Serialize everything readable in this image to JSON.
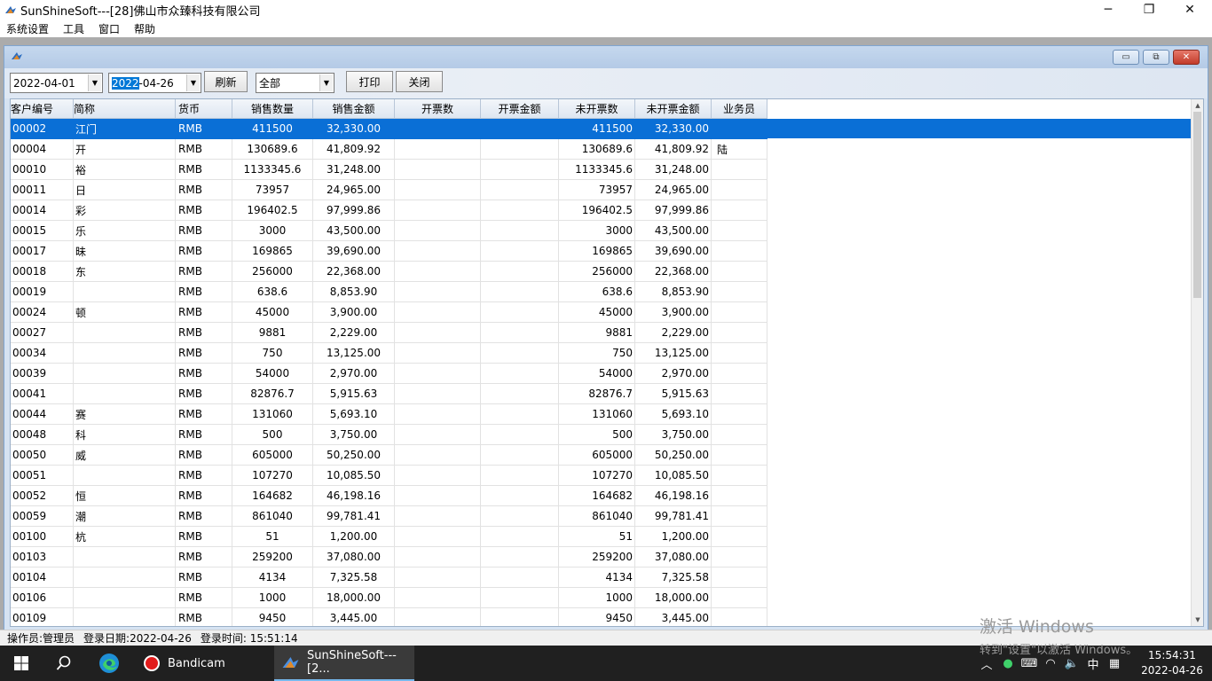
{
  "window": {
    "title": "SunShineSoft---[28]佛山市众臻科技有限公司",
    "minimize": "─",
    "maximize": "❐",
    "close": "✕"
  },
  "menu": [
    "系统设置",
    "工具",
    "窗口",
    "帮助"
  ],
  "child_window": {
    "minimize": "▭",
    "restore": "⧉",
    "close": "✕"
  },
  "toolbar": {
    "date_from": "2022-04-01",
    "date_to_selected": "2022",
    "date_to_rest": "-04-26",
    "refresh": "刷新",
    "filter": "全部",
    "print": "打印",
    "close": "关闭"
  },
  "columns": [
    "客户编号",
    "简称",
    "货币",
    "销售数量",
    "销售金额",
    "开票数",
    "开票金额",
    "未开票数",
    "未开票金额",
    "业务员"
  ],
  "rows": [
    {
      "code": "00002",
      "name": "江门",
      "cur": "RMB",
      "qty": "411500",
      "amt": "32,330.00",
      "inv": "",
      "invamt": "",
      "unq": "411500",
      "unamt": "32,330.00",
      "rep": ""
    },
    {
      "code": "00004",
      "name": "开",
      "cur": "RMB",
      "qty": "130689.6",
      "amt": "41,809.92",
      "inv": "",
      "invamt": "",
      "unq": "130689.6",
      "unamt": "41,809.92",
      "rep": "陆"
    },
    {
      "code": "00010",
      "name": "裕",
      "cur": "RMB",
      "qty": "1133345.6",
      "amt": "31,248.00",
      "inv": "",
      "invamt": "",
      "unq": "1133345.6",
      "unamt": "31,248.00",
      "rep": ""
    },
    {
      "code": "00011",
      "name": "日",
      "cur": "RMB",
      "qty": "73957",
      "amt": "24,965.00",
      "inv": "",
      "invamt": "",
      "unq": "73957",
      "unamt": "24,965.00",
      "rep": ""
    },
    {
      "code": "00014",
      "name": "彩",
      "cur": "RMB",
      "qty": "196402.5",
      "amt": "97,999.86",
      "inv": "",
      "invamt": "",
      "unq": "196402.5",
      "unamt": "97,999.86",
      "rep": ""
    },
    {
      "code": "00015",
      "name": "乐",
      "cur": "RMB",
      "qty": "3000",
      "amt": "43,500.00",
      "inv": "",
      "invamt": "",
      "unq": "3000",
      "unamt": "43,500.00",
      "rep": ""
    },
    {
      "code": "00017",
      "name": "昧",
      "cur": "RMB",
      "qty": "169865",
      "amt": "39,690.00",
      "inv": "",
      "invamt": "",
      "unq": "169865",
      "unamt": "39,690.00",
      "rep": ""
    },
    {
      "code": "00018",
      "name": "东",
      "cur": "RMB",
      "qty": "256000",
      "amt": "22,368.00",
      "inv": "",
      "invamt": "",
      "unq": "256000",
      "unamt": "22,368.00",
      "rep": ""
    },
    {
      "code": "00019",
      "name": "",
      "cur": "RMB",
      "qty": "638.6",
      "amt": "8,853.90",
      "inv": "",
      "invamt": "",
      "unq": "638.6",
      "unamt": "8,853.90",
      "rep": ""
    },
    {
      "code": "00024",
      "name": "顿",
      "cur": "RMB",
      "qty": "45000",
      "amt": "3,900.00",
      "inv": "",
      "invamt": "",
      "unq": "45000",
      "unamt": "3,900.00",
      "rep": ""
    },
    {
      "code": "00027",
      "name": "",
      "cur": "RMB",
      "qty": "9881",
      "amt": "2,229.00",
      "inv": "",
      "invamt": "",
      "unq": "9881",
      "unamt": "2,229.00",
      "rep": ""
    },
    {
      "code": "00034",
      "name": "",
      "cur": "RMB",
      "qty": "750",
      "amt": "13,125.00",
      "inv": "",
      "invamt": "",
      "unq": "750",
      "unamt": "13,125.00",
      "rep": ""
    },
    {
      "code": "00039",
      "name": "",
      "cur": "RMB",
      "qty": "54000",
      "amt": "2,970.00",
      "inv": "",
      "invamt": "",
      "unq": "54000",
      "unamt": "2,970.00",
      "rep": ""
    },
    {
      "code": "00041",
      "name": "",
      "cur": "RMB",
      "qty": "82876.7",
      "amt": "5,915.63",
      "inv": "",
      "invamt": "",
      "unq": "82876.7",
      "unamt": "5,915.63",
      "rep": ""
    },
    {
      "code": "00044",
      "name": "赛",
      "cur": "RMB",
      "qty": "131060",
      "amt": "5,693.10",
      "inv": "",
      "invamt": "",
      "unq": "131060",
      "unamt": "5,693.10",
      "rep": ""
    },
    {
      "code": "00048",
      "name": "科",
      "cur": "RMB",
      "qty": "500",
      "amt": "3,750.00",
      "inv": "",
      "invamt": "",
      "unq": "500",
      "unamt": "3,750.00",
      "rep": ""
    },
    {
      "code": "00050",
      "name": "威",
      "cur": "RMB",
      "qty": "605000",
      "amt": "50,250.00",
      "inv": "",
      "invamt": "",
      "unq": "605000",
      "unamt": "50,250.00",
      "rep": ""
    },
    {
      "code": "00051",
      "name": "",
      "cur": "RMB",
      "qty": "107270",
      "amt": "10,085.50",
      "inv": "",
      "invamt": "",
      "unq": "107270",
      "unamt": "10,085.50",
      "rep": ""
    },
    {
      "code": "00052",
      "name": "恒",
      "cur": "RMB",
      "qty": "164682",
      "amt": "46,198.16",
      "inv": "",
      "invamt": "",
      "unq": "164682",
      "unamt": "46,198.16",
      "rep": ""
    },
    {
      "code": "00059",
      "name": "潮",
      "cur": "RMB",
      "qty": "861040",
      "amt": "99,781.41",
      "inv": "",
      "invamt": "",
      "unq": "861040",
      "unamt": "99,781.41",
      "rep": ""
    },
    {
      "code": "00100",
      "name": "杭",
      "cur": "RMB",
      "qty": "51",
      "amt": "1,200.00",
      "inv": "",
      "invamt": "",
      "unq": "51",
      "unamt": "1,200.00",
      "rep": ""
    },
    {
      "code": "00103",
      "name": "",
      "cur": "RMB",
      "qty": "259200",
      "amt": "37,080.00",
      "inv": "",
      "invamt": "",
      "unq": "259200",
      "unamt": "37,080.00",
      "rep": ""
    },
    {
      "code": "00104",
      "name": "",
      "cur": "RMB",
      "qty": "4134",
      "amt": "7,325.58",
      "inv": "",
      "invamt": "",
      "unq": "4134",
      "unamt": "7,325.58",
      "rep": ""
    },
    {
      "code": "00106",
      "name": "",
      "cur": "RMB",
      "qty": "1000",
      "amt": "18,000.00",
      "inv": "",
      "invamt": "",
      "unq": "1000",
      "unamt": "18,000.00",
      "rep": ""
    },
    {
      "code": "00109",
      "name": "",
      "cur": "RMB",
      "qty": "9450",
      "amt": "3,445.00",
      "inv": "",
      "invamt": "",
      "unq": "9450",
      "unamt": "3,445.00",
      "rep": ""
    }
  ],
  "status": {
    "operator": "操作员:管理员",
    "login_date": "登录日期:2022-04-26",
    "login_time": "登录时间: 15:51:14"
  },
  "watermark": {
    "line1": "激活 Windows",
    "line2": "转到\"设置\"以激活 Windows。"
  },
  "taskbar": {
    "bandicam": "Bandicam",
    "sunshine": "SunShineSoft---[2...",
    "ime": "中",
    "time": "15:54:31",
    "date": "2022-04-26"
  },
  "colors": {
    "selection": "#0a6fd6",
    "taskbar": "#202020"
  }
}
